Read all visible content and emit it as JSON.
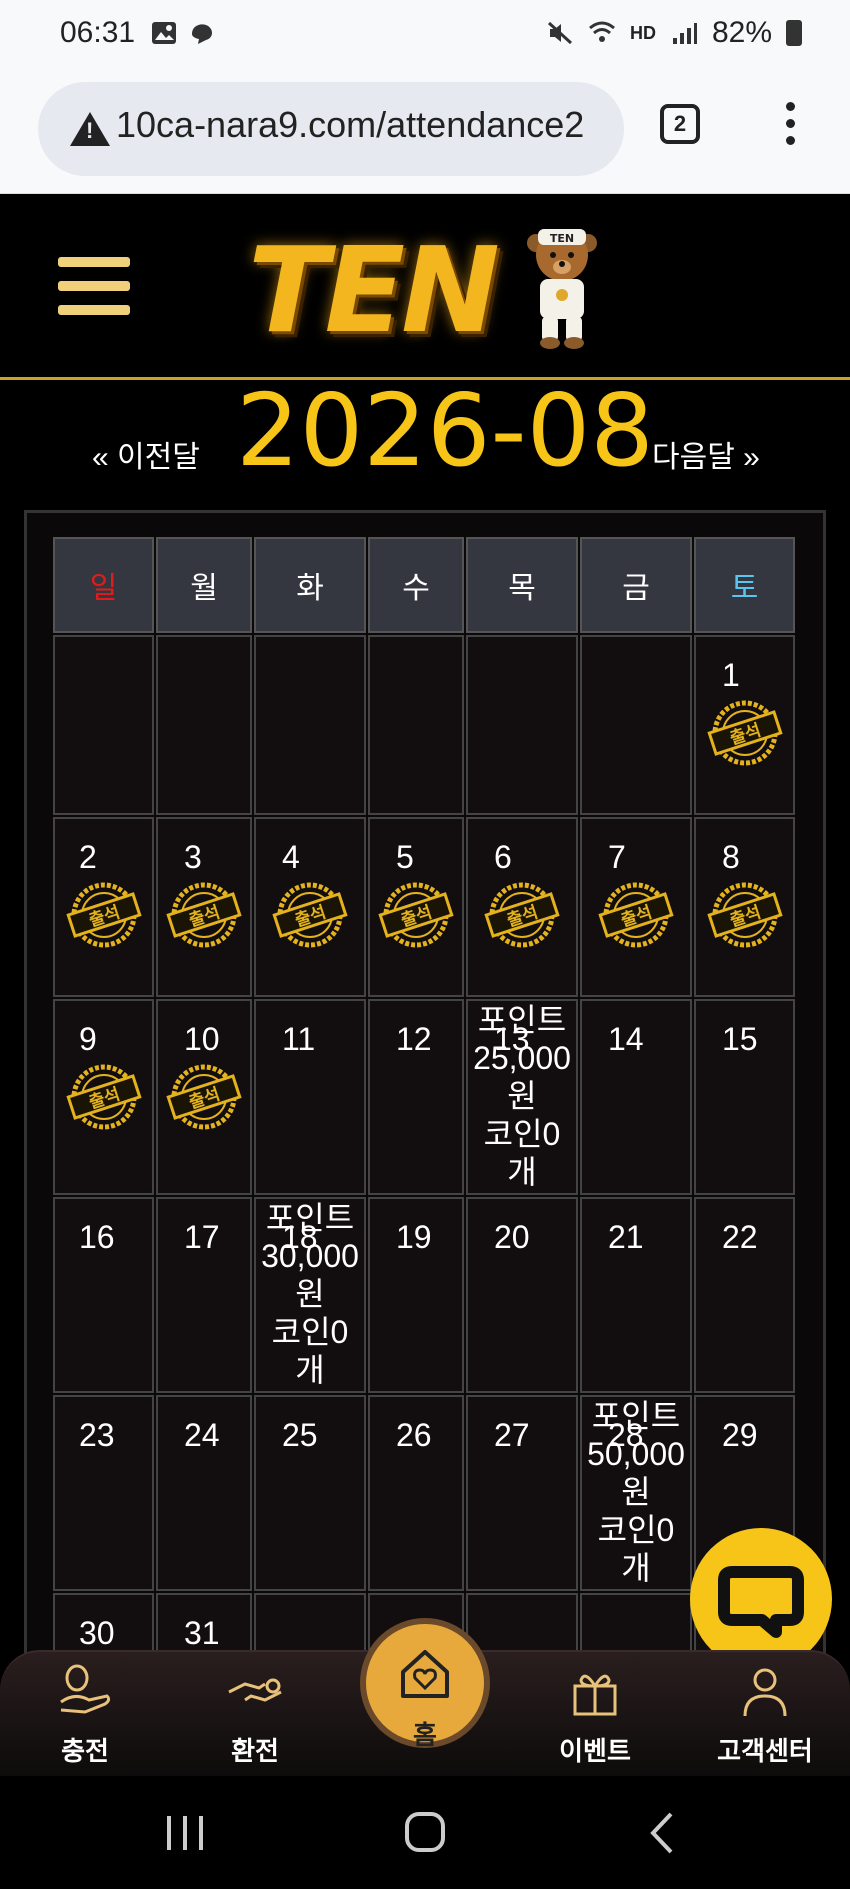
{
  "status_bar": {
    "time": "06:31",
    "battery": "82%",
    "hd_label": "HD"
  },
  "browser": {
    "url": "10ca-nara9.com/attendance2",
    "tab_count": "2"
  },
  "header": {
    "logo_text": "TEN",
    "bear_cap_text": "TEN"
  },
  "month_nav": {
    "prev": "« 이전달",
    "title": "2026-08",
    "next": "다음달 »"
  },
  "calendar": {
    "weekdays": [
      "일",
      "월",
      "화",
      "수",
      "목",
      "금",
      "토"
    ],
    "stamp_label": "출석",
    "weeks": [
      [
        "",
        "",
        "",
        "",
        "",
        "",
        "1"
      ],
      [
        "2",
        "3",
        "4",
        "5",
        "6",
        "7",
        "8"
      ],
      [
        "9",
        "10",
        "11",
        "12",
        "13",
        "14",
        "15"
      ],
      [
        "16",
        "17",
        "18",
        "19",
        "20",
        "21",
        "22"
      ],
      [
        "23",
        "24",
        "25",
        "26",
        "27",
        "28",
        "29"
      ],
      [
        "30",
        "31",
        "",
        "",
        "",
        "",
        ""
      ]
    ],
    "attended_days": [
      "1",
      "2",
      "3",
      "4",
      "5",
      "6",
      "7",
      "8",
      "9",
      "10"
    ],
    "rewards": {
      "13": [
        "포인트",
        "25,000",
        "원",
        "코인0",
        "개"
      ],
      "18": [
        "포인트",
        "30,000",
        "원",
        "코인0",
        "개"
      ],
      "28": [
        "포인트",
        "50,000",
        "원",
        "코인0",
        "개"
      ]
    }
  },
  "bottom_nav": {
    "charge": "충전",
    "exchange": "환전",
    "home": "홈",
    "event": "이벤트",
    "support": "고객센터"
  },
  "colors": {
    "gold": "#f7c518",
    "sunday": "#e01c1c",
    "saturday": "#5bc5f2",
    "home_button": "#e8a93c"
  }
}
